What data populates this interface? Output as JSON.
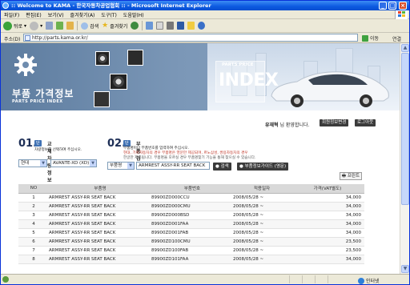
{
  "window": {
    "title": ":: Welcome to KAMA - 한국자동차공업협회 :: - Microsoft Internet Explorer"
  },
  "menu": [
    "파일(F)",
    "편집(E)",
    "보기(V)",
    "즐겨찾기(A)",
    "도구(T)",
    "도움말(H)"
  ],
  "toolbar": {
    "back_label": "뒤로",
    "search_label": "검색",
    "favorites_label": "즐겨찾기"
  },
  "address": {
    "label": "주소(D)",
    "url": "http://parts.kama.or.kr/",
    "go_label": "이동",
    "links_label": "연결"
  },
  "banner": {
    "title": "부품 가격정보",
    "subtitle": "PARTS PRICE INDEX",
    "badge_sub": "PARTS PRICE",
    "badge_main": "INDEX"
  },
  "user": {
    "name": "유재혁",
    "welcome": "님 환영합니다.",
    "edit_button": "회원정보변경",
    "logout_button": "로그아웃"
  },
  "step1": {
    "number": "01.",
    "tag": "단계",
    "heading": "교체차량정보",
    "note": "차량정보를 선택하여 주십시오.",
    "maker": "현대",
    "model": "AVANTE-XD (XD)"
  },
  "step2": {
    "number": "02.",
    "tag": "단계",
    "heading": "부품검색",
    "notes": [
      "부품명이나 부품번호를 입력하여 주십시오.",
      "현대, 기아자동차의 경우 부품명은 영문만 제공되며, 르노삼성, 쌍용자동차의 경우",
      "한글만 제공됩니다. 부품명을 모르실 경우 부품명찾기 기능을 통해 찾으실 수 있습니다."
    ],
    "search_type": "부품명",
    "search_value": "ARMREST ASSY-RR SEAT BACK",
    "search_button": "검색",
    "guide_button": "부품정보가이드 (영문)"
  },
  "print_button": "프린트",
  "table": {
    "headers": [
      "NO",
      "부품명",
      "부품번호",
      "적용일자",
      "가격(VAT별도)"
    ],
    "rows": [
      [
        "1",
        "ARMREST ASSY-RR SEAT BACK",
        "89900ZD000CCU",
        "2008/05/28 ~",
        "34,000"
      ],
      [
        "2",
        "ARMREST ASSY-RR SEAT BACK",
        "89900ZD000CMU",
        "2008/05/28 ~",
        "34,000"
      ],
      [
        "3",
        "ARMREST ASSY-RR SEAT BACK",
        "89900ZD000BSD",
        "2008/05/28 ~",
        "34,000"
      ],
      [
        "4",
        "ARMREST ASSY-RR SEAT BACK",
        "89900ZD001FAA",
        "2008/05/28 ~",
        "34,000"
      ],
      [
        "5",
        "ARMREST ASSY-RR SEAT BACK",
        "89900ZD001FAB",
        "2008/05/28 ~",
        "34,000"
      ],
      [
        "6",
        "ARMREST ASSY-RR SEAT BACK",
        "89900ZD100CMU",
        "2008/05/28 ~",
        "23,500"
      ],
      [
        "7",
        "ARMREST ASSY-RR SEAT BACK",
        "89900ZD100FAB",
        "2008/05/28 ~",
        "23,500"
      ],
      [
        "8",
        "ARMREST ASSY-RR SEAT BACK",
        "89900ZD101FAA",
        "2008/05/28 ~",
        "34,000"
      ]
    ]
  },
  "status": {
    "zone": "인터넷"
  },
  "colors": {
    "accent": "#4072b4",
    "banner": "#6f8cae",
    "titlebar": "#0b59e0"
  }
}
